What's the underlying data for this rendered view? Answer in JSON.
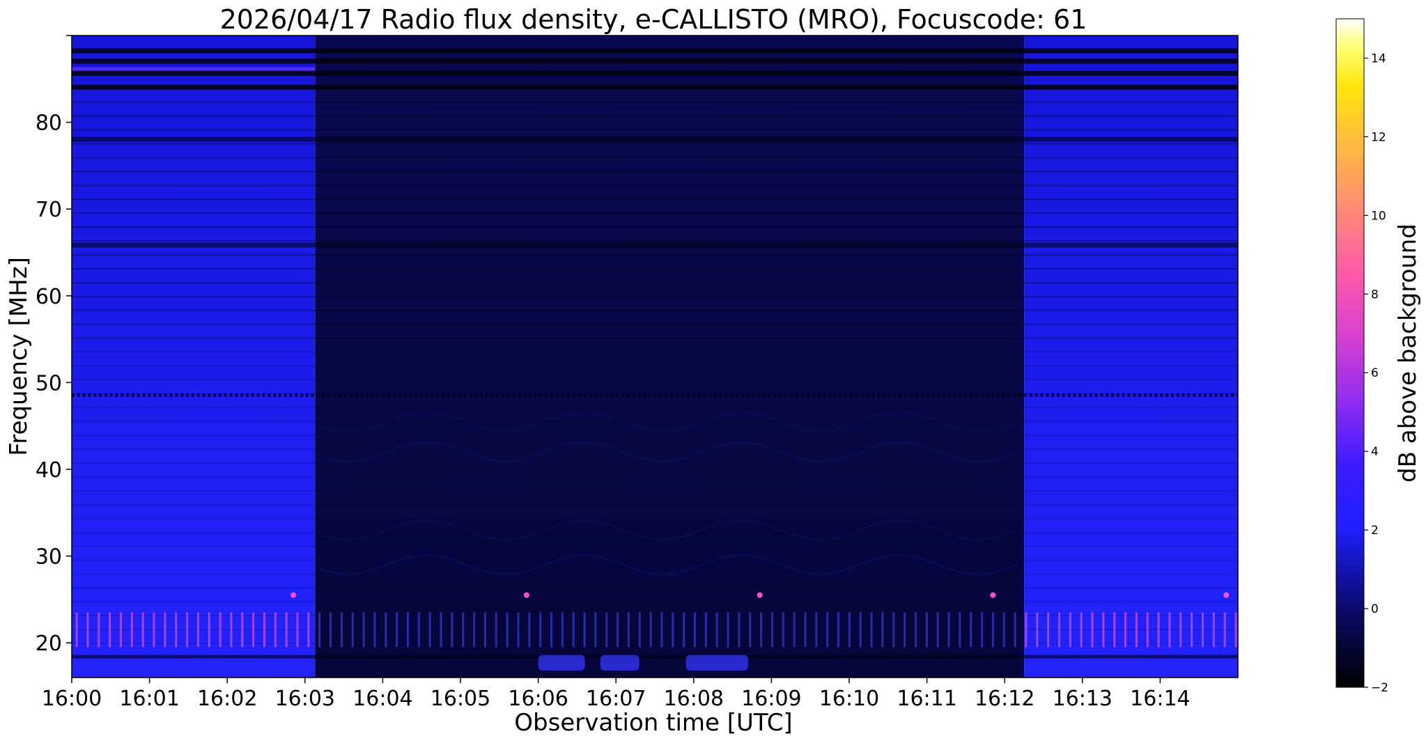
{
  "chart_data": {
    "type": "heatmap",
    "title": "2026/04/17  Radio flux density, e-CALLISTO (MRO), Focuscode: 61",
    "xlabel": "Observation time [UTC]",
    "ylabel": "Frequency [MHz]",
    "x_range_minutes": [
      0,
      15
    ],
    "x_ticks": [
      {
        "value": 0,
        "label": "16:00"
      },
      {
        "value": 1,
        "label": "16:01"
      },
      {
        "value": 2,
        "label": "16:02"
      },
      {
        "value": 3,
        "label": "16:03"
      },
      {
        "value": 4,
        "label": "16:04"
      },
      {
        "value": 5,
        "label": "16:05"
      },
      {
        "value": 6,
        "label": "16:06"
      },
      {
        "value": 7,
        "label": "16:07"
      },
      {
        "value": 8,
        "label": "16:08"
      },
      {
        "value": 9,
        "label": "16:09"
      },
      {
        "value": 10,
        "label": "16:10"
      },
      {
        "value": 11,
        "label": "16:11"
      },
      {
        "value": 12,
        "label": "16:12"
      },
      {
        "value": 13,
        "label": "16:13"
      },
      {
        "value": 14,
        "label": "16:14"
      }
    ],
    "ylim": [
      16,
      90
    ],
    "y_ticks": [
      {
        "value": 20,
        "label": "20"
      },
      {
        "value": 30,
        "label": "30"
      },
      {
        "value": 40,
        "label": "40"
      },
      {
        "value": 50,
        "label": "50"
      },
      {
        "value": 60,
        "label": "60"
      },
      {
        "value": 70,
        "label": "70"
      },
      {
        "value": 80,
        "label": "80"
      },
      {
        "value": 90,
        "label": ""
      }
    ],
    "colorbar": {
      "label": "dB above background",
      "range": [
        -2,
        15
      ],
      "colormap": "gnuplot2",
      "ticks": [
        {
          "value": -2,
          "label": "−2"
        },
        {
          "value": 0,
          "label": "0"
        },
        {
          "value": 2,
          "label": "2"
        },
        {
          "value": 4,
          "label": "4"
        },
        {
          "value": 6,
          "label": "6"
        },
        {
          "value": 8,
          "label": "8"
        },
        {
          "value": 10,
          "label": "10"
        },
        {
          "value": 12,
          "label": "12"
        },
        {
          "value": 14,
          "label": "14"
        }
      ]
    },
    "grid": false,
    "regions": [
      {
        "name": "bright",
        "time_start": 0.0,
        "time_end": 3.13,
        "level_db": 2.0
      },
      {
        "name": "dark",
        "time_start": 3.13,
        "time_end": 12.25,
        "level_db": -1.0
      },
      {
        "name": "bright",
        "time_start": 12.25,
        "time_end": 15.0,
        "level_db": 2.0
      }
    ],
    "colors": {
      "bright_low": "#2323ff",
      "bright_high": "#1515d8",
      "dark_low": "#06063a",
      "dark_high": "#080850",
      "band_dark": "#000010",
      "band_mid": "#14148c",
      "spot": "#ff4fc8",
      "purple_stripe": "#6a2cff"
    }
  }
}
